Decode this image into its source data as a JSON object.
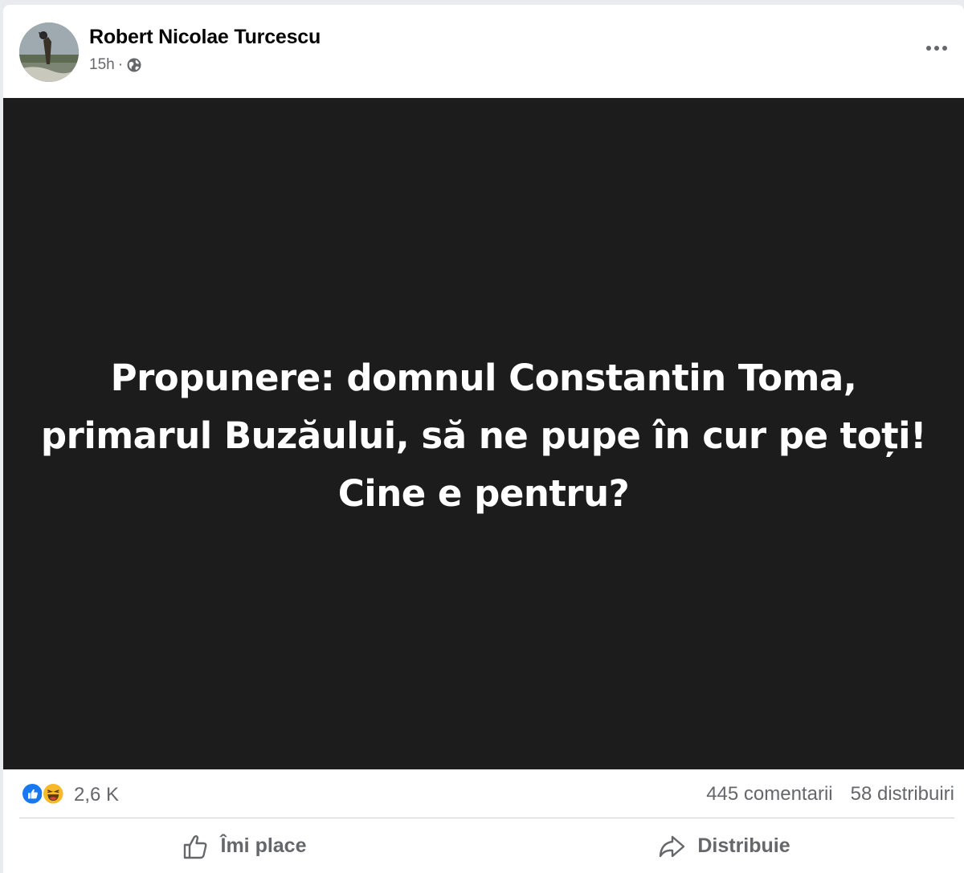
{
  "post": {
    "author": "Robert Nicolae Turcescu",
    "time": "15h",
    "separator": "·",
    "privacy_icon": "globe-icon",
    "more_icon": "more-horizontal-icon",
    "image_text": {
      "line1": "Propunere: domnul Constantin Toma,",
      "line2": "primarul Buzăului, să ne pupe în cur pe toți!",
      "line3": "Cine e pentru?"
    }
  },
  "stats": {
    "reaction_icons": [
      "like-reaction-icon",
      "haha-reaction-icon"
    ],
    "reactions_count": "2,6 K",
    "comments": "445 comentarii",
    "shares": "58 distribuiri"
  },
  "actions": {
    "like_label": "Îmi place",
    "share_label": "Distribuie"
  },
  "colors": {
    "image_background": "#1c1c1c",
    "like_blue": "#1877f2",
    "haha_yellow": "#f7b928",
    "secondary_text": "#65676b"
  }
}
